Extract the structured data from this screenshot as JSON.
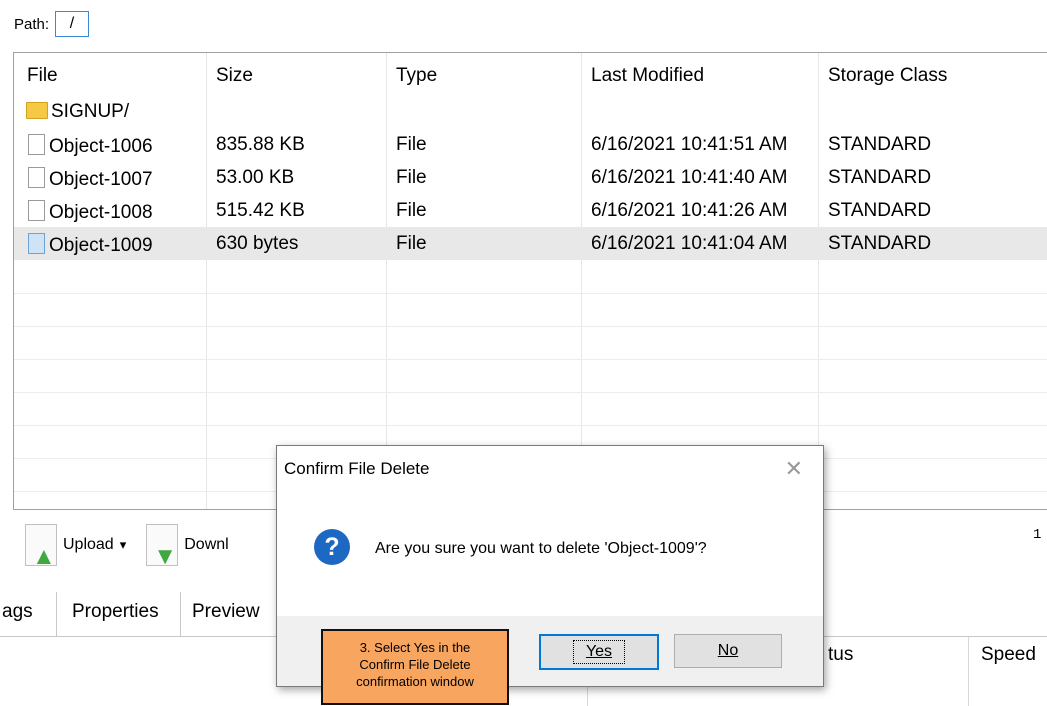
{
  "path": {
    "label": "Path:",
    "value": "/"
  },
  "columns": [
    "File",
    "Size",
    "Type",
    "Last Modified",
    "Storage Class"
  ],
  "rows": [
    {
      "name": "SIGNUP/",
      "size": "",
      "type": "",
      "modified": "",
      "storage": "",
      "icon": "folder-icon"
    },
    {
      "name": "Object-1006",
      "size": "835.88 KB",
      "type": "File",
      "modified": "6/16/2021 10:41:51 AM",
      "storage": "STANDARD",
      "icon": "file-icon"
    },
    {
      "name": "Object-1007",
      "size": "53.00 KB",
      "type": "File",
      "modified": "6/16/2021 10:41:40 AM",
      "storage": "STANDARD",
      "icon": "file-icon"
    },
    {
      "name": "Object-1008",
      "size": "515.42 KB",
      "type": "File",
      "modified": "6/16/2021 10:41:26 AM",
      "storage": "STANDARD",
      "icon": "file-icon"
    },
    {
      "name": "Object-1009",
      "size": "630 bytes",
      "type": "File",
      "modified": "6/16/2021 10:41:04 AM",
      "storage": "STANDARD",
      "icon": "file-icon",
      "selected": true
    }
  ],
  "toolbar": {
    "upload_label": "Upload",
    "upload_arrow": "▾",
    "download_label": "Downl",
    "side_text": "1"
  },
  "tabs": [
    "ags",
    "Properties",
    "Preview"
  ],
  "bottom_headers": {
    "status": "tus",
    "speed": "Speed"
  },
  "dialog": {
    "title": "Confirm File Delete",
    "close_glyph": "✕",
    "question_glyph": "?",
    "message": "Are you sure you want to delete 'Object-1009'?",
    "yes_label": "Yes",
    "no_label": "No"
  },
  "callout": {
    "line1": "3. Select Yes in the",
    "line2": "Confirm File Delete",
    "line3": "confirmation window"
  },
  "colors": {
    "accent": "#0078d7",
    "question_icon": "#1d68c2",
    "callout_bg": "#f7a55f",
    "folder": "#f5c846"
  }
}
